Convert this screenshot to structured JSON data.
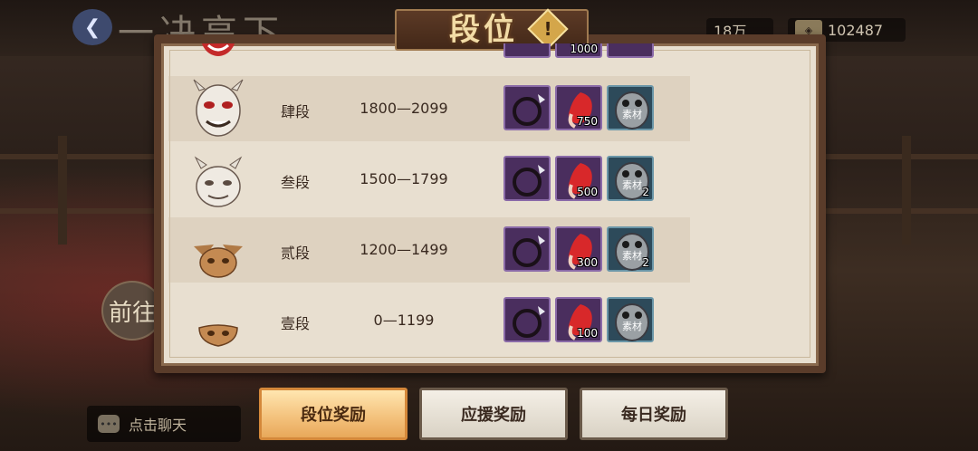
{
  "header": {
    "bg_title": "一决高下",
    "resources": [
      {
        "icon": "coin-icon",
        "value": "18万"
      },
      {
        "icon": "jade-icon",
        "value": "102487"
      }
    ]
  },
  "panel": {
    "title": "段位",
    "info_icon": "!"
  },
  "ranks": [
    {
      "name": "肆段",
      "range": "1800—2099",
      "rewards": [
        {
          "icon": "ring-icon",
          "count": ""
        },
        {
          "icon": "spirit-orb-icon",
          "count": "750"
        },
        {
          "icon": "daruma-material-icon",
          "count": ""
        }
      ]
    },
    {
      "name": "叁段",
      "range": "1500—1799",
      "rewards": [
        {
          "icon": "ring-icon",
          "count": ""
        },
        {
          "icon": "spirit-orb-icon",
          "count": "500"
        },
        {
          "icon": "daruma-material-icon",
          "count": "2"
        }
      ]
    },
    {
      "name": "贰段",
      "range": "1200—1499",
      "rewards": [
        {
          "icon": "ring-icon",
          "count": ""
        },
        {
          "icon": "spirit-orb-icon",
          "count": "300"
        },
        {
          "icon": "daruma-material-icon",
          "count": "2"
        }
      ]
    },
    {
      "name": "壹段",
      "range": "0—1199",
      "rewards": [
        {
          "icon": "ring-icon",
          "count": ""
        },
        {
          "icon": "spirit-orb-icon",
          "count": "100"
        },
        {
          "icon": "daruma-material-icon",
          "count": ""
        }
      ]
    }
  ],
  "partial_row": {
    "orb_count": "1000"
  },
  "material_label": "素材",
  "left": {
    "goto_label": "前往",
    "chat_label": "点击聊天"
  },
  "tabs": [
    {
      "label": "段位奖励"
    },
    {
      "label": "应援奖励"
    },
    {
      "label": "每日奖励"
    }
  ],
  "colors": {
    "paper": "#e8dfd0",
    "frame": "#5a3c2a",
    "reward_purple": "#4a2e5e",
    "reward_blue": "#2d4a5a",
    "tab_active": "#f3c07a"
  }
}
